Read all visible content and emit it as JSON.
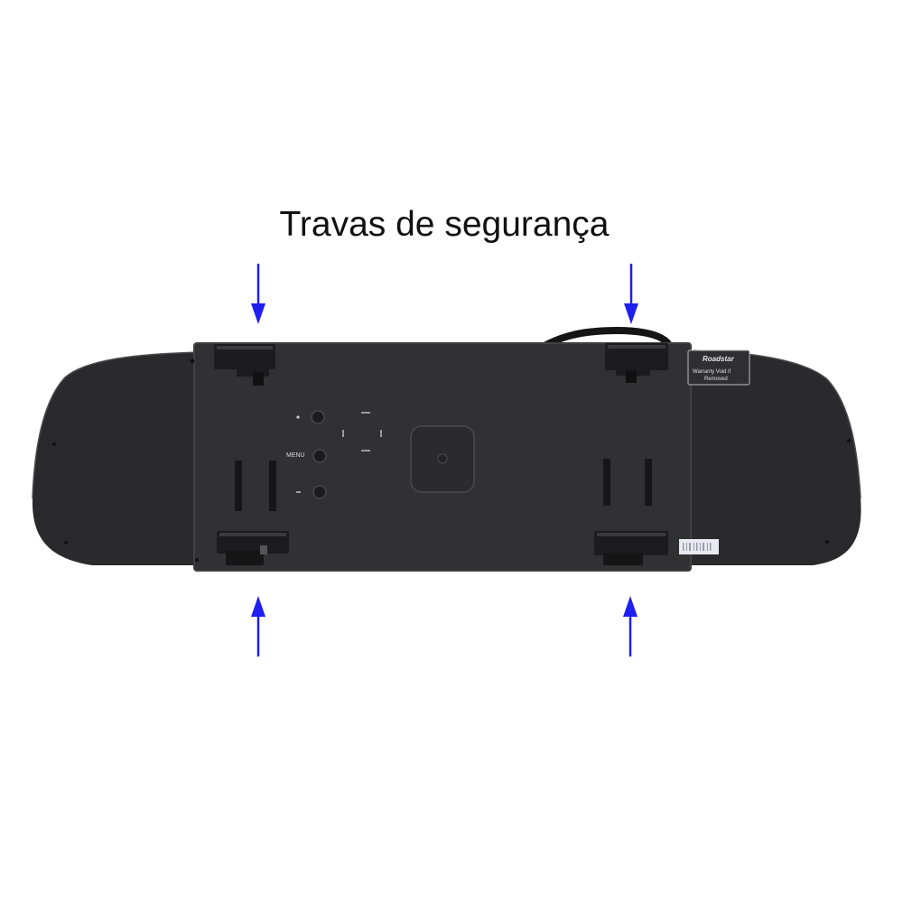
{
  "heading": "Travas de segurança",
  "device": {
    "menu_label": "MENU",
    "sticker_brand": "Roadstar",
    "sticker_line1": "Warranty Void if",
    "sticker_line2": "Removed"
  },
  "icons": [
    "arrow-down-icon",
    "arrow-up-icon"
  ],
  "colors": {
    "background": "#ffffff",
    "arrow": "#1f1ff0",
    "body": "#2a2a2d",
    "panel": "#313134",
    "clip": "#1c1c1e",
    "cable": "#151515"
  }
}
